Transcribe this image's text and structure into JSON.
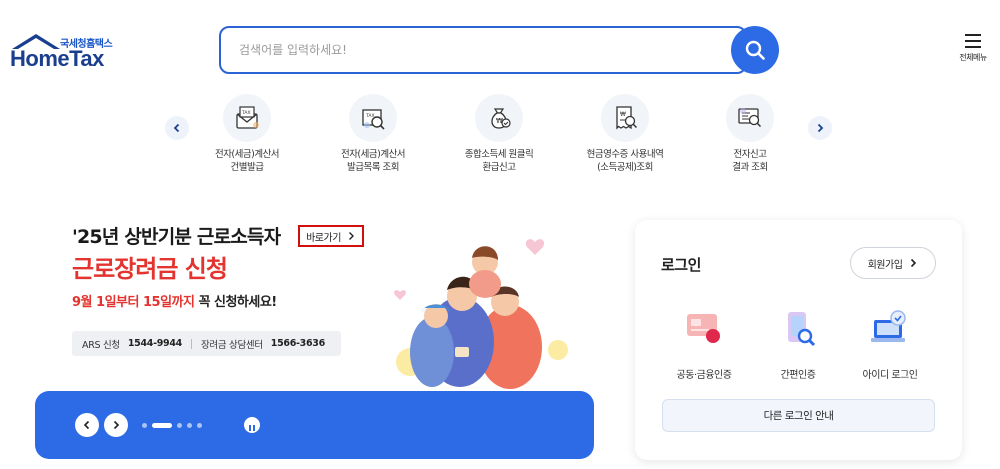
{
  "header": {
    "logo_sub": "국세청홈택스",
    "logo_main": "HomeTax",
    "search_placeholder": "검색어를 입력하세요!",
    "menu_label": "전체메뉴"
  },
  "quick_menu": [
    {
      "line1": "전자(세금)계산서",
      "line2": "건별발급",
      "icon": "tax-invoice-envelope-icon"
    },
    {
      "line1": "전자(세금)계산서",
      "line2": "발급목록 조회",
      "icon": "tax-invoice-search-icon"
    },
    {
      "line1": "종합소득세 원클릭",
      "line2": "환급신고",
      "icon": "money-bag-refund-icon"
    },
    {
      "line1": "현금영수증 사용내역",
      "line2": "(소득공제)조회",
      "icon": "receipt-search-icon"
    },
    {
      "line1": "전자신고",
      "line2": "결과 조회",
      "icon": "e-filing-result-icon"
    }
  ],
  "banner": {
    "line1": "'25년 상반기분 근로소득자",
    "go_label": "바로가기",
    "line2": "근로장려금 신청",
    "line3_red": "9월 1일부터 15일까지",
    "line3_rest": " 꼭 신청하세요!",
    "ars_label": "ARS 신청",
    "ars_number": "1544-9944",
    "center_label": "장려금 상담센터",
    "center_number": "1566-3636"
  },
  "slider": {
    "dot_count": 5,
    "active_index": 0
  },
  "login": {
    "title": "로그인",
    "join_label": "회원가입",
    "options": [
      {
        "label": "공동·금융인증",
        "icon": "certificate-card-icon"
      },
      {
        "label": "간편인증",
        "icon": "mobile-auth-icon"
      },
      {
        "label": "아이디 로그인",
        "icon": "id-login-laptop-icon"
      }
    ],
    "other_label": "다른 로그인 안내"
  },
  "colors": {
    "primary_blue": "#2c6be5",
    "banner_red": "#e3342f",
    "logo_navy": "#1b3f8f"
  }
}
